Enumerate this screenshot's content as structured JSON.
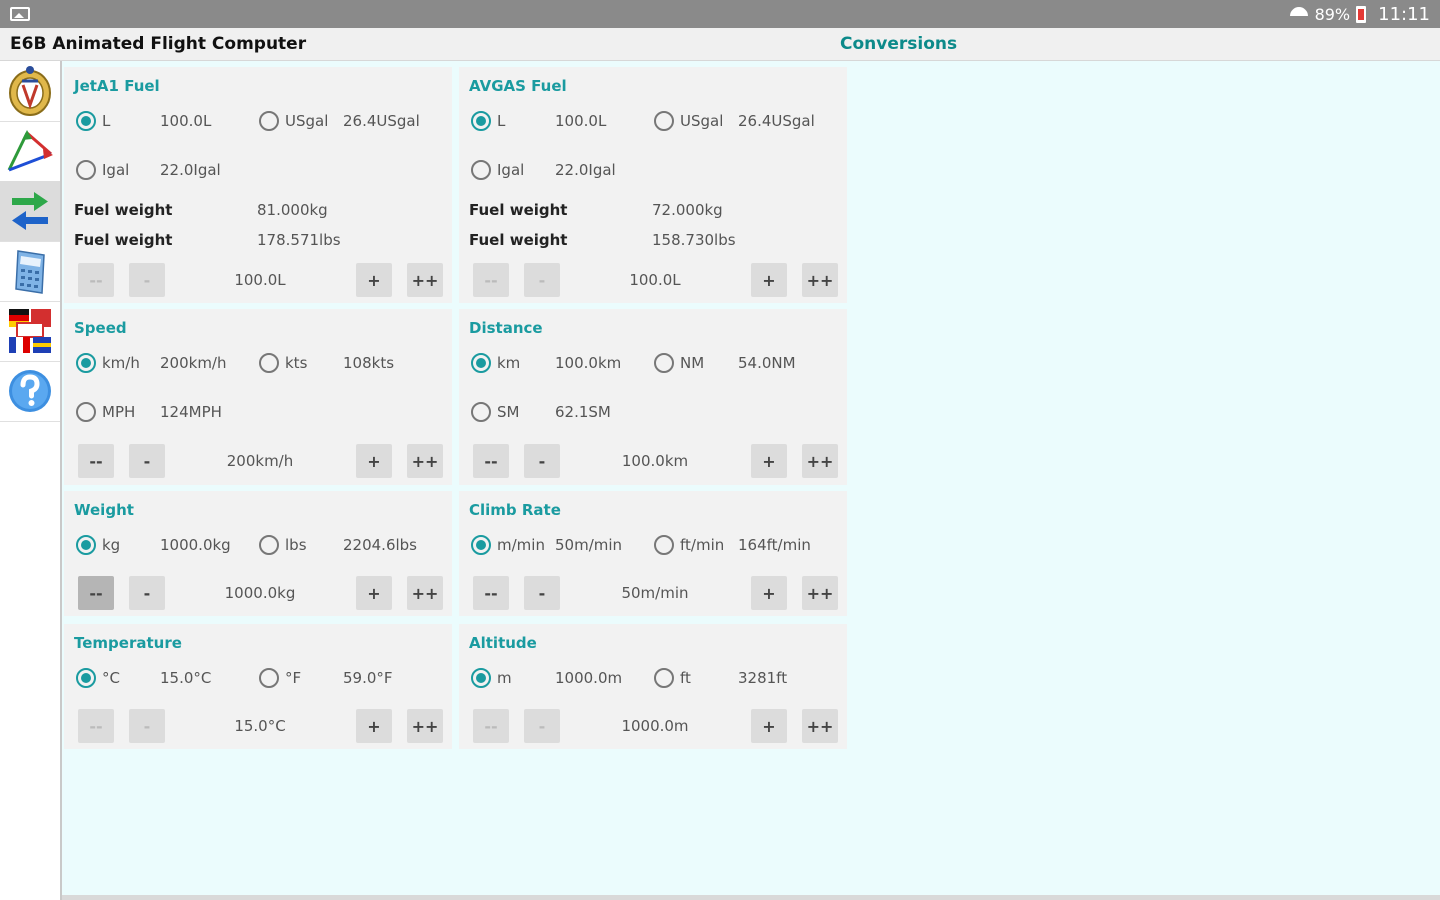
{
  "status_bar": {
    "battery": "89%",
    "time": "11:11"
  },
  "title_bar": {
    "app_title": "E6B Animated Flight Computer",
    "section_title": "Conversions"
  },
  "sidebar": {
    "items": [
      {
        "icon": "badge-icon"
      },
      {
        "icon": "wind-triangle-icon"
      },
      {
        "icon": "conversions-arrows-icon",
        "active": true
      },
      {
        "icon": "calculator-icon"
      },
      {
        "icon": "language-flags-icon"
      },
      {
        "icon": "help-icon"
      }
    ]
  },
  "panels": {
    "jeta1": {
      "title": "JetA1 Fuel",
      "options": [
        {
          "unit": "L",
          "value": "100.0L",
          "selected": true
        },
        {
          "unit": "USgal",
          "value": "26.4USgal",
          "selected": false
        },
        {
          "unit": "Igal",
          "value": "22.0Igal",
          "selected": false
        }
      ],
      "weights": [
        {
          "label": "Fuel weight",
          "value": "81.000kg"
        },
        {
          "label": "Fuel weight",
          "value": "178.571lbs"
        }
      ],
      "stepper": {
        "dec_big": "--",
        "dec": "-",
        "value": "100.0L",
        "inc": "+",
        "inc_big": "++"
      }
    },
    "avgas": {
      "title": "AVGAS Fuel",
      "options": [
        {
          "unit": "L",
          "value": "100.0L",
          "selected": true
        },
        {
          "unit": "USgal",
          "value": "26.4USgal",
          "selected": false
        },
        {
          "unit": "Igal",
          "value": "22.0Igal",
          "selected": false
        }
      ],
      "weights": [
        {
          "label": "Fuel weight",
          "value": "72.000kg"
        },
        {
          "label": "Fuel weight",
          "value": "158.730lbs"
        }
      ],
      "stepper": {
        "dec_big": "--",
        "dec": "-",
        "value": "100.0L",
        "inc": "+",
        "inc_big": "++"
      }
    },
    "speed": {
      "title": "Speed",
      "options": [
        {
          "unit": "km/h",
          "value": "200km/h",
          "selected": true
        },
        {
          "unit": "kts",
          "value": "108kts",
          "selected": false
        },
        {
          "unit": "MPH",
          "value": "124MPH",
          "selected": false
        }
      ],
      "stepper": {
        "dec_big": "--",
        "dec": "-",
        "value": "200km/h",
        "inc": "+",
        "inc_big": "++"
      }
    },
    "distance": {
      "title": "Distance",
      "options": [
        {
          "unit": "km",
          "value": "100.0km",
          "selected": true
        },
        {
          "unit": "NM",
          "value": "54.0NM",
          "selected": false
        },
        {
          "unit": "SM",
          "value": "62.1SM",
          "selected": false
        }
      ],
      "stepper": {
        "dec_big": "--",
        "dec": "-",
        "value": "100.0km",
        "inc": "+",
        "inc_big": "++"
      }
    },
    "weight": {
      "title": "Weight",
      "options": [
        {
          "unit": "kg",
          "value": "1000.0kg",
          "selected": true
        },
        {
          "unit": "lbs",
          "value": "2204.6lbs",
          "selected": false
        }
      ],
      "stepper": {
        "dec_big": "--",
        "dec": "-",
        "value": "1000.0kg",
        "inc": "+",
        "inc_big": "++"
      }
    },
    "climb": {
      "title": "Climb Rate",
      "options": [
        {
          "unit": "m/min",
          "value": "50m/min",
          "selected": true
        },
        {
          "unit": "ft/min",
          "value": "164ft/min",
          "selected": false
        }
      ],
      "stepper": {
        "dec_big": "--",
        "dec": "-",
        "value": "50m/min",
        "inc": "+",
        "inc_big": "++"
      }
    },
    "temperature": {
      "title": "Temperature",
      "options": [
        {
          "unit": "°C",
          "value": "15.0°C",
          "selected": true
        },
        {
          "unit": "°F",
          "value": "59.0°F",
          "selected": false
        }
      ],
      "stepper": {
        "dec_big": "--",
        "dec": "-",
        "value": "15.0°C",
        "inc": "+",
        "inc_big": "++"
      }
    },
    "altitude": {
      "title": "Altitude",
      "options": [
        {
          "unit": "m",
          "value": "1000.0m",
          "selected": true
        },
        {
          "unit": "ft",
          "value": "3281ft",
          "selected": false
        }
      ],
      "stepper": {
        "dec_big": "--",
        "dec": "-",
        "value": "1000.0m",
        "inc": "+",
        "inc_big": "++"
      }
    }
  },
  "colors": {
    "accent": "#1a9ba0",
    "status_bar": "#8a8a8a",
    "content_bg": "#ebfcfd",
    "panel_bg": "#f2f2f2"
  }
}
